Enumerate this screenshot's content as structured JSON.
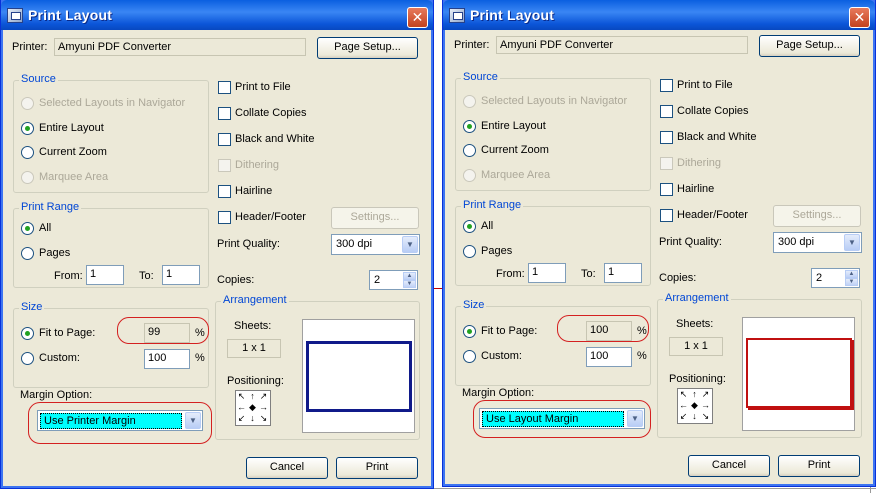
{
  "left": {
    "title": "Print Layout",
    "printer_label": "Printer:",
    "printer_value": "Amyuni PDF Converter",
    "page_setup": "Page Setup...",
    "source_title": "Source",
    "source_options": [
      "Selected Layouts in Navigator",
      "Entire Layout",
      "Current Zoom",
      "Marquee Area"
    ],
    "checks": [
      "Print to File",
      "Collate Copies",
      "Black and White",
      "Dithering",
      "Hairline",
      "Header/Footer"
    ],
    "settings": "Settings...",
    "print_quality_label": "Print Quality:",
    "print_quality_value": "300 dpi",
    "print_range_title": "Print Range",
    "range_all": "All",
    "range_pages": "Pages",
    "from_label": "From:",
    "from_value": "1",
    "to_label": "To:",
    "to_value": "1",
    "copies_label": "Copies:",
    "copies_value": "2",
    "size_title": "Size",
    "fit_label": "Fit to Page:",
    "fit_value": "99",
    "custom_label": "Custom:",
    "custom_value": "100",
    "percent": "%",
    "margin_label": "Margin Option:",
    "margin_value": "Use Printer Margin",
    "arrangement_title": "Arrangement",
    "sheets_label": "Sheets:",
    "sheets_value": "1 x 1",
    "positioning_label": "Positioning:",
    "cancel": "Cancel",
    "print": "Print"
  },
  "right": {
    "title": "Print Layout",
    "printer_label": "Printer:",
    "printer_value": "Amyuni PDF Converter",
    "page_setup": "Page Setup...",
    "source_title": "Source",
    "source_options": [
      "Selected Layouts in Navigator",
      "Entire Layout",
      "Current Zoom",
      "Marquee Area"
    ],
    "checks": [
      "Print to File",
      "Collate Copies",
      "Black and White",
      "Dithering",
      "Hairline",
      "Header/Footer"
    ],
    "settings": "Settings...",
    "print_quality_label": "Print Quality:",
    "print_quality_value": "300 dpi",
    "print_range_title": "Print Range",
    "range_all": "All",
    "range_pages": "Pages",
    "from_label": "From:",
    "from_value": "1",
    "to_label": "To:",
    "to_value": "1",
    "copies_label": "Copies:",
    "copies_value": "2",
    "size_title": "Size",
    "fit_label": "Fit to Page:",
    "fit_value": "100",
    "custom_label": "Custom:",
    "custom_value": "100",
    "percent": "%",
    "margin_label": "Margin Option:",
    "margin_value": "Use Layout Margin",
    "arrangement_title": "Arrangement",
    "sheets_label": "Sheets:",
    "sheets_value": "1 x 1",
    "positioning_label": "Positioning:",
    "cancel": "Cancel",
    "print": "Print"
  },
  "icons": {
    "close": "close-icon",
    "app": "print-layout-app-icon",
    "dropdown": "chevron-down-icon",
    "spin": "spin-arrows-icon"
  },
  "colors": {
    "titlebar": "#0a5fe0",
    "group_title": "#0046d5",
    "highlight": "#d42020",
    "selected_combo": "#00ffff"
  }
}
